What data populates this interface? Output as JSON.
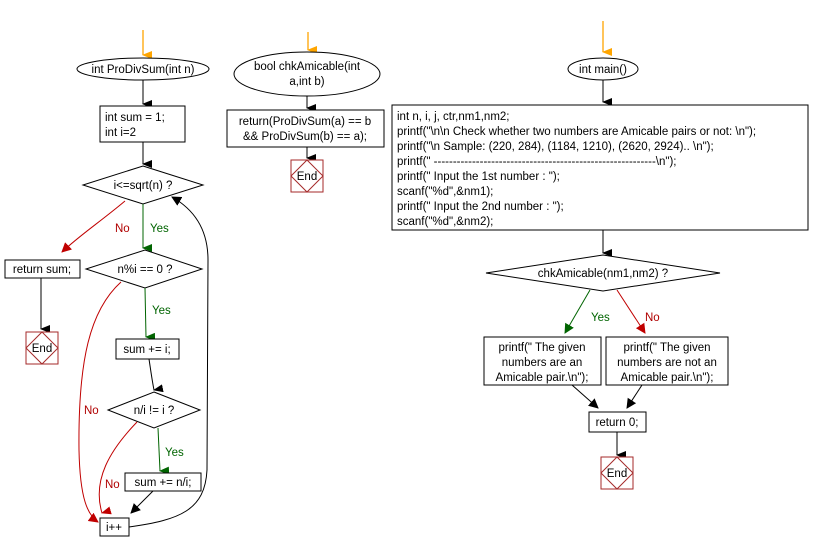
{
  "colors": {
    "start_arrow": "#ffa500",
    "yes": "#006400",
    "no": "#c00000",
    "end_border": "#a52a2a",
    "line": "#000000"
  },
  "prodivsum": {
    "start": "int ProDivSum(int n)",
    "init": [
      "int sum = 1;",
      "int i=2"
    ],
    "loop_cond": "i<=sqrt(n) ?",
    "return": "return sum;",
    "div_cond": "n%i == 0 ?",
    "add_i": "sum += i;",
    "neq_cond": "n/i != i ?",
    "add_ni": "sum += n/i;",
    "incr": "i++",
    "end": "End",
    "labels": {
      "yes": "Yes",
      "no": "No"
    }
  },
  "chkamicable": {
    "start": [
      "bool chkAmicable(int",
      "a,int b)"
    ],
    "body": [
      "return(ProDivSum(a) == b",
      "&& ProDivSum(b) == a);"
    ],
    "end": "End"
  },
  "main": {
    "start": "int main()",
    "body": [
      "int n, i, j, ctr,nm1,nm2;",
      "printf(\"\\n\\n Check whether two numbers are Amicable pairs or not: \\n\");",
      "printf(\"\\n Sample: (220, 284), (1184, 1210), (2620, 2924).. \\n\");",
      "printf(\" ----------------------------------------------------------\\n\");",
      "printf(\" Input the 1st number : \");",
      "scanf(\"%d\",&nm1);",
      "printf(\" Input the 2nd number : \");",
      "scanf(\"%d\",&nm2);"
    ],
    "cond": "chkAmicable(nm1,nm2) ?",
    "yes_box": [
      "printf(\" The given",
      "numbers are an",
      "Amicable pair.\\n\");"
    ],
    "no_box": [
      "printf(\" The given",
      "numbers are not an",
      "Amicable pair.\\n\");"
    ],
    "return": "return 0;",
    "end": "End",
    "labels": {
      "yes": "Yes",
      "no": "No"
    }
  }
}
